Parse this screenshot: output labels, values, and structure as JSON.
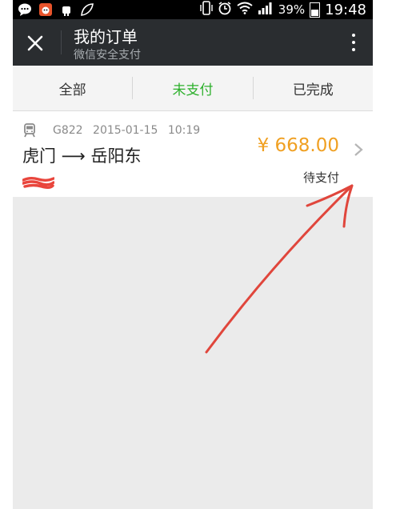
{
  "status_bar": {
    "battery": "39%",
    "time": "19:48"
  },
  "header": {
    "title": "我的订单",
    "subtitle": "微信安全支付",
    "close_icon": "close-icon",
    "more_icon": "more-vertical-icon"
  },
  "tabs": [
    {
      "label": "全部",
      "active": false
    },
    {
      "label": "未支付",
      "active": true
    },
    {
      "label": "已完成",
      "active": false
    }
  ],
  "order": {
    "train": "G822",
    "date": "2015-01-15",
    "time": "10:19",
    "route": "虎门 ⟶ 岳阳东",
    "price": "¥ 668.00",
    "status": "待支付"
  },
  "colors": {
    "header_bg": "#2a2d30",
    "accent_green": "#2db02c",
    "price_orange": "#f0a022",
    "annotation_red": "#e0463c"
  }
}
